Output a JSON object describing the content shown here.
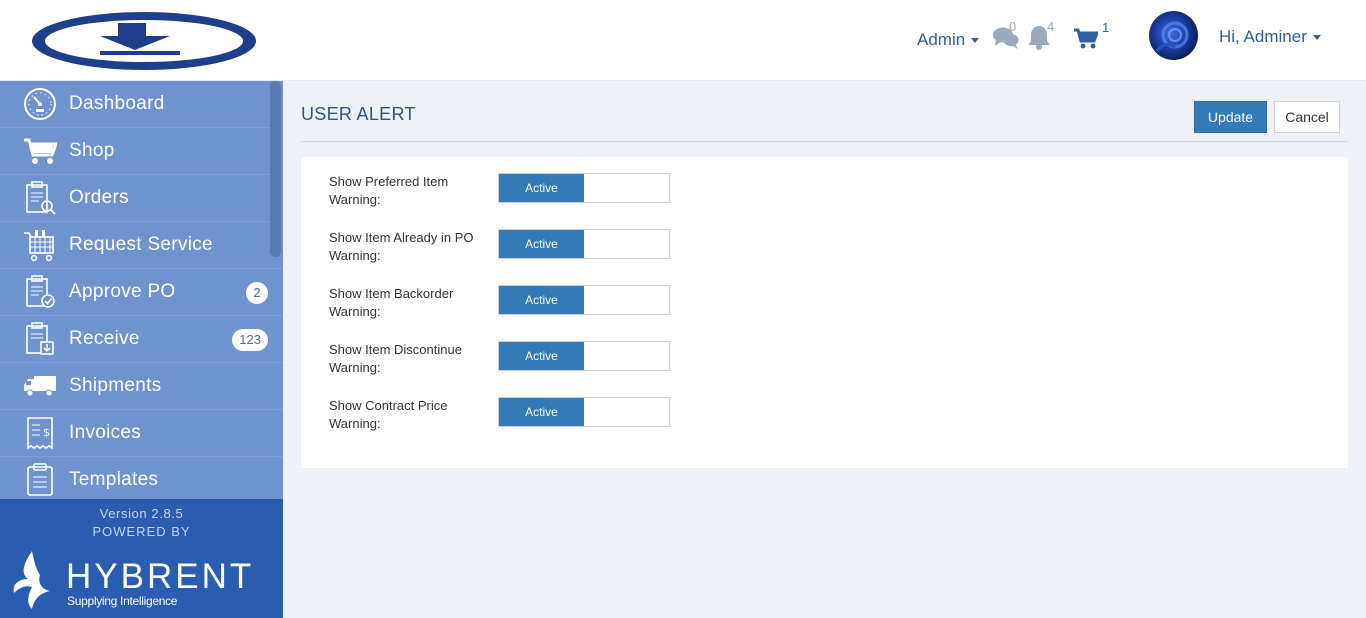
{
  "header": {
    "admin_menu": "Admin",
    "messages_count": "0",
    "notifications_count": "4",
    "cart_count": "1",
    "user_greeting": "Hi, Adminer"
  },
  "sidebar": {
    "items": [
      {
        "label": "Dashboard",
        "icon": "dashboard-icon"
      },
      {
        "label": "Shop",
        "icon": "cart-icon"
      },
      {
        "label": "Orders",
        "icon": "orders-icon"
      },
      {
        "label": "Request Service",
        "icon": "request-service-icon"
      },
      {
        "label": "Approve PO",
        "icon": "approve-icon",
        "badge": "2"
      },
      {
        "label": "Receive",
        "icon": "receive-icon",
        "badge": "123"
      },
      {
        "label": "Shipments",
        "icon": "truck-icon"
      },
      {
        "label": "Invoices",
        "icon": "invoice-icon"
      },
      {
        "label": "Templates",
        "icon": "clipboard-icon"
      }
    ],
    "version": "Version 2.8.5",
    "powered_by": "POWERED BY",
    "brand": "HYBRENT",
    "tagline": "Supplying Intelligence"
  },
  "main": {
    "title": "USER ALERT",
    "update_label": "Update",
    "cancel_label": "Cancel",
    "settings": [
      {
        "label": "Show Preferred Item Warning:",
        "state": "Active"
      },
      {
        "label": "Show Item Already in PO Warning:",
        "state": "Active"
      },
      {
        "label": "Show Item Backorder Warning:",
        "state": "Active"
      },
      {
        "label": "Show Item Discontinue Warning:",
        "state": "Active"
      },
      {
        "label": "Show Contract Price Warning:",
        "state": "Active"
      }
    ]
  },
  "colors": {
    "primary": "#337ab7",
    "sidebar": "#6f93cf",
    "sidebar_footer": "#2a5cb0",
    "header_text": "#2f5f9e"
  }
}
